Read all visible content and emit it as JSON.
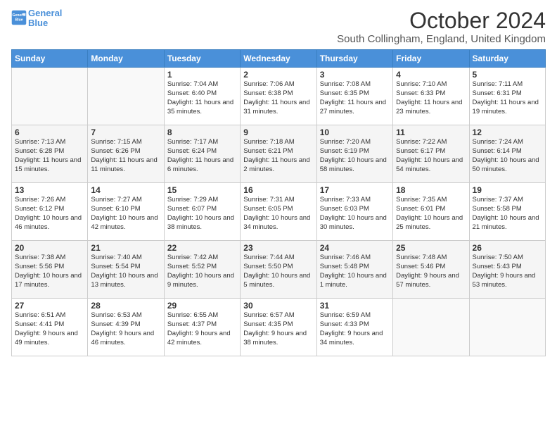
{
  "logo": {
    "line1": "General",
    "line2": "Blue"
  },
  "title": "October 2024",
  "subtitle": "South Collingham, England, United Kingdom",
  "days_of_week": [
    "Sunday",
    "Monday",
    "Tuesday",
    "Wednesday",
    "Thursday",
    "Friday",
    "Saturday"
  ],
  "weeks": [
    [
      {
        "day": "",
        "info": ""
      },
      {
        "day": "",
        "info": ""
      },
      {
        "day": "1",
        "info": "Sunrise: 7:04 AM\nSunset: 6:40 PM\nDaylight: 11 hours and 35 minutes."
      },
      {
        "day": "2",
        "info": "Sunrise: 7:06 AM\nSunset: 6:38 PM\nDaylight: 11 hours and 31 minutes."
      },
      {
        "day": "3",
        "info": "Sunrise: 7:08 AM\nSunset: 6:35 PM\nDaylight: 11 hours and 27 minutes."
      },
      {
        "day": "4",
        "info": "Sunrise: 7:10 AM\nSunset: 6:33 PM\nDaylight: 11 hours and 23 minutes."
      },
      {
        "day": "5",
        "info": "Sunrise: 7:11 AM\nSunset: 6:31 PM\nDaylight: 11 hours and 19 minutes."
      }
    ],
    [
      {
        "day": "6",
        "info": "Sunrise: 7:13 AM\nSunset: 6:28 PM\nDaylight: 11 hours and 15 minutes."
      },
      {
        "day": "7",
        "info": "Sunrise: 7:15 AM\nSunset: 6:26 PM\nDaylight: 11 hours and 11 minutes."
      },
      {
        "day": "8",
        "info": "Sunrise: 7:17 AM\nSunset: 6:24 PM\nDaylight: 11 hours and 6 minutes."
      },
      {
        "day": "9",
        "info": "Sunrise: 7:18 AM\nSunset: 6:21 PM\nDaylight: 11 hours and 2 minutes."
      },
      {
        "day": "10",
        "info": "Sunrise: 7:20 AM\nSunset: 6:19 PM\nDaylight: 10 hours and 58 minutes."
      },
      {
        "day": "11",
        "info": "Sunrise: 7:22 AM\nSunset: 6:17 PM\nDaylight: 10 hours and 54 minutes."
      },
      {
        "day": "12",
        "info": "Sunrise: 7:24 AM\nSunset: 6:14 PM\nDaylight: 10 hours and 50 minutes."
      }
    ],
    [
      {
        "day": "13",
        "info": "Sunrise: 7:26 AM\nSunset: 6:12 PM\nDaylight: 10 hours and 46 minutes."
      },
      {
        "day": "14",
        "info": "Sunrise: 7:27 AM\nSunset: 6:10 PM\nDaylight: 10 hours and 42 minutes."
      },
      {
        "day": "15",
        "info": "Sunrise: 7:29 AM\nSunset: 6:07 PM\nDaylight: 10 hours and 38 minutes."
      },
      {
        "day": "16",
        "info": "Sunrise: 7:31 AM\nSunset: 6:05 PM\nDaylight: 10 hours and 34 minutes."
      },
      {
        "day": "17",
        "info": "Sunrise: 7:33 AM\nSunset: 6:03 PM\nDaylight: 10 hours and 30 minutes."
      },
      {
        "day": "18",
        "info": "Sunrise: 7:35 AM\nSunset: 6:01 PM\nDaylight: 10 hours and 25 minutes."
      },
      {
        "day": "19",
        "info": "Sunrise: 7:37 AM\nSunset: 5:58 PM\nDaylight: 10 hours and 21 minutes."
      }
    ],
    [
      {
        "day": "20",
        "info": "Sunrise: 7:38 AM\nSunset: 5:56 PM\nDaylight: 10 hours and 17 minutes."
      },
      {
        "day": "21",
        "info": "Sunrise: 7:40 AM\nSunset: 5:54 PM\nDaylight: 10 hours and 13 minutes."
      },
      {
        "day": "22",
        "info": "Sunrise: 7:42 AM\nSunset: 5:52 PM\nDaylight: 10 hours and 9 minutes."
      },
      {
        "day": "23",
        "info": "Sunrise: 7:44 AM\nSunset: 5:50 PM\nDaylight: 10 hours and 5 minutes."
      },
      {
        "day": "24",
        "info": "Sunrise: 7:46 AM\nSunset: 5:48 PM\nDaylight: 10 hours and 1 minute."
      },
      {
        "day": "25",
        "info": "Sunrise: 7:48 AM\nSunset: 5:46 PM\nDaylight: 9 hours and 57 minutes."
      },
      {
        "day": "26",
        "info": "Sunrise: 7:50 AM\nSunset: 5:43 PM\nDaylight: 9 hours and 53 minutes."
      }
    ],
    [
      {
        "day": "27",
        "info": "Sunrise: 6:51 AM\nSunset: 4:41 PM\nDaylight: 9 hours and 49 minutes."
      },
      {
        "day": "28",
        "info": "Sunrise: 6:53 AM\nSunset: 4:39 PM\nDaylight: 9 hours and 46 minutes."
      },
      {
        "day": "29",
        "info": "Sunrise: 6:55 AM\nSunset: 4:37 PM\nDaylight: 9 hours and 42 minutes."
      },
      {
        "day": "30",
        "info": "Sunrise: 6:57 AM\nSunset: 4:35 PM\nDaylight: 9 hours and 38 minutes."
      },
      {
        "day": "31",
        "info": "Sunrise: 6:59 AM\nSunset: 4:33 PM\nDaylight: 9 hours and 34 minutes."
      },
      {
        "day": "",
        "info": ""
      },
      {
        "day": "",
        "info": ""
      }
    ]
  ]
}
